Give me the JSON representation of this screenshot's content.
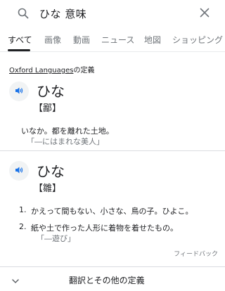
{
  "search": {
    "query": "ひな 意味"
  },
  "tabs": [
    {
      "label": "すべて"
    },
    {
      "label": "画像"
    },
    {
      "label": "動画"
    },
    {
      "label": "ニュース"
    },
    {
      "label": "地図"
    },
    {
      "label": "ショッピング"
    }
  ],
  "source": {
    "brand": "Oxford Languages",
    "suffix": "の定義"
  },
  "entries": [
    {
      "word": "ひな",
      "kanji": "【鄙】",
      "definitions": [
        {
          "text": "いなか。都を離れた土地。",
          "example": "「―にはまれな美人」"
        }
      ]
    },
    {
      "word": "ひな",
      "kanji": "【雛】",
      "definitions": [
        {
          "num": "1.",
          "text": "かえって間もない、小さな、鳥の子。ひよこ。",
          "example": ""
        },
        {
          "num": "2.",
          "text": "紙や土で作った人形に着物を着せたもの。",
          "example": "「―遊び」"
        }
      ]
    }
  ],
  "feedback_label": "フィードバック",
  "more_label": "翻訳とその他の定義",
  "icons": {
    "search": "search-icon",
    "clear": "close-icon",
    "speaker": "speaker-icon",
    "expand": "chevron-down-icon"
  },
  "colors": {
    "speaker_blue": "#1a73e8",
    "muted": "#70757a",
    "text": "#202124"
  }
}
